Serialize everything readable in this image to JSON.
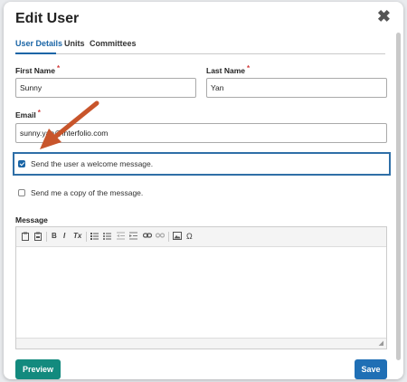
{
  "modal": {
    "title": "Edit User",
    "close_symbol": "✖"
  },
  "tabs": [
    {
      "label": "User Details",
      "active": true
    },
    {
      "label": "Units",
      "active": false
    },
    {
      "label": "Committees",
      "active": false
    }
  ],
  "form": {
    "first_name": {
      "label": "First Name",
      "required_mark": "*",
      "value": "Sunny"
    },
    "last_name": {
      "label": "Last Name",
      "required_mark": "*",
      "value": "Yan"
    },
    "email": {
      "label": "Email",
      "required_mark": "*",
      "value": "sunny.yan@interfolio.com"
    },
    "welcome_checkbox": {
      "label": "Send the user a welcome message.",
      "checked": true
    },
    "copy_checkbox": {
      "label": "Send me a copy of the message.",
      "checked": false
    },
    "message": {
      "label": "Message",
      "value": ""
    }
  },
  "toolbar_icons": [
    "paste-text-icon",
    "paste-word-icon",
    "bold-icon",
    "italic-icon",
    "remove-format-icon",
    "numbered-list-icon",
    "bulleted-list-icon",
    "outdent-icon",
    "indent-icon",
    "link-icon",
    "unlink-icon",
    "image-icon",
    "special-char-icon"
  ],
  "toolbar_glyphs": {
    "bold": "B",
    "italic": "I",
    "remove_format": "Tx",
    "special_char": "Ω"
  },
  "buttons": {
    "preview": "Preview",
    "save": "Save"
  },
  "colors": {
    "primary": "#1f6fb5",
    "accent_teal": "#138a7e",
    "annotation_arrow": "#c8552b",
    "required": "#d23b3b"
  }
}
